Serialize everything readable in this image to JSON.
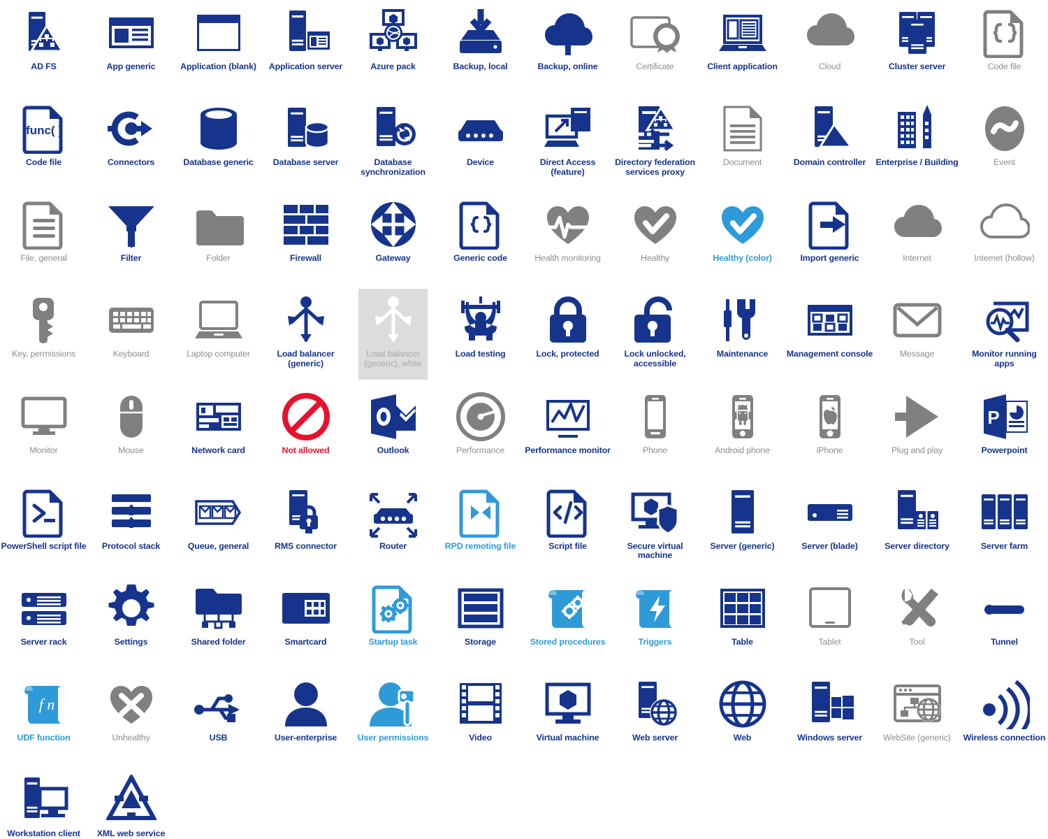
{
  "palette": {
    "dark_blue": "#16348c",
    "navy": "#13307f",
    "gray": "#808080",
    "label_gray": "#8d8d8d",
    "light_blue": "#2f9ad8",
    "red": "#e8112d",
    "white": "#ffffff",
    "shade_bg": "#dcdcdc",
    "background": "#ffffff"
  },
  "grid": {
    "columns": 12,
    "rows": 8,
    "total_icons": 96
  },
  "icons": [
    {
      "label": "AD FS",
      "color": "blue",
      "shape": "adfs"
    },
    {
      "label": "App generic",
      "color": "blue",
      "shape": "app-generic"
    },
    {
      "label": "Application (blank)",
      "color": "blue",
      "shape": "app-blank"
    },
    {
      "label": "Application server",
      "color": "blue",
      "shape": "app-server"
    },
    {
      "label": "Azure pack",
      "color": "blue",
      "shape": "azure-pack"
    },
    {
      "label": "Backup, local",
      "color": "blue",
      "shape": "backup-local"
    },
    {
      "label": "Backup, online",
      "color": "blue",
      "shape": "backup-online"
    },
    {
      "label": "Certificate",
      "color": "gray",
      "shape": "certificate"
    },
    {
      "label": "Client application",
      "color": "blue",
      "shape": "client-application"
    },
    {
      "label": "Cloud",
      "color": "gray",
      "shape": "cloud"
    },
    {
      "label": "Cluster server",
      "color": "blue",
      "shape": "cluster-server"
    },
    {
      "label": "Code file",
      "color": "gray",
      "shape": "code-file-braces"
    },
    {
      "label": "Code file",
      "color": "blue",
      "shape": "code-file-func"
    },
    {
      "label": "Connectors",
      "color": "blue",
      "shape": "connectors"
    },
    {
      "label": "Database generic",
      "color": "blue",
      "shape": "database-generic"
    },
    {
      "label": "Database server",
      "color": "blue",
      "shape": "database-server"
    },
    {
      "label": "Database synchronization",
      "color": "blue",
      "shape": "database-sync"
    },
    {
      "label": "Device",
      "color": "blue",
      "shape": "device"
    },
    {
      "label": "Direct Access (feature)",
      "color": "blue",
      "shape": "direct-access"
    },
    {
      "label": "Directory federation services proxy",
      "color": "blue",
      "shape": "dir-fed-proxy"
    },
    {
      "label": "Document",
      "color": "gray",
      "shape": "document"
    },
    {
      "label": "Domain controller",
      "color": "blue",
      "shape": "domain-controller"
    },
    {
      "label": "Enterprise / Building",
      "color": "blue",
      "shape": "enterprise-building"
    },
    {
      "label": "Event",
      "color": "gray",
      "shape": "event"
    },
    {
      "label": "File, general",
      "color": "gray",
      "shape": "file-general"
    },
    {
      "label": "Filter",
      "color": "blue",
      "shape": "filter"
    },
    {
      "label": "Folder",
      "color": "gray",
      "shape": "folder"
    },
    {
      "label": "Firewall",
      "color": "blue",
      "shape": "firewall"
    },
    {
      "label": "Gateway",
      "color": "blue",
      "shape": "gateway"
    },
    {
      "label": "Generic code",
      "color": "blue",
      "shape": "generic-code"
    },
    {
      "label": "Health monitoring",
      "color": "gray",
      "shape": "health-monitoring"
    },
    {
      "label": "Healthy",
      "color": "gray",
      "shape": "healthy"
    },
    {
      "label": "Healthy (color)",
      "color": "lblue",
      "shape": "healthy-color"
    },
    {
      "label": "Import generic",
      "color": "blue",
      "shape": "import-generic"
    },
    {
      "label": "Internet",
      "color": "gray",
      "shape": "internet"
    },
    {
      "label": "Internet (hollow)",
      "color": "gray",
      "shape": "internet-hollow"
    },
    {
      "label": "Key, permissions",
      "color": "gray",
      "shape": "key-permissions"
    },
    {
      "label": "Keyboard",
      "color": "gray",
      "shape": "keyboard"
    },
    {
      "label": "Laptop computer",
      "color": "gray",
      "shape": "laptop-computer"
    },
    {
      "label": "Load balancer (generic)",
      "color": "blue",
      "shape": "load-balancer"
    },
    {
      "label": "Load balancer (generic), white",
      "color": "white",
      "shape": "load-balancer-white",
      "shaded": true
    },
    {
      "label": "Load testing",
      "color": "blue",
      "shape": "load-testing"
    },
    {
      "label": "Lock, protected",
      "color": "blue",
      "shape": "lock-protected"
    },
    {
      "label": "Lock unlocked, accessible",
      "color": "blue",
      "shape": "lock-unlocked"
    },
    {
      "label": "Maintenance",
      "color": "blue",
      "shape": "maintenance"
    },
    {
      "label": "Management console",
      "color": "blue",
      "shape": "management-console"
    },
    {
      "label": "Message",
      "color": "gray",
      "shape": "message"
    },
    {
      "label": "Monitor running apps",
      "color": "blue",
      "shape": "monitor-running-apps"
    },
    {
      "label": "Monitor",
      "color": "gray",
      "shape": "monitor"
    },
    {
      "label": "Mouse",
      "color": "gray",
      "shape": "mouse"
    },
    {
      "label": "Network card",
      "color": "blue",
      "shape": "network-card"
    },
    {
      "label": "Not allowed",
      "color": "red",
      "shape": "not-allowed"
    },
    {
      "label": "Outlook",
      "color": "blue",
      "shape": "outlook"
    },
    {
      "label": "Performance",
      "color": "gray",
      "shape": "performance"
    },
    {
      "label": "Performance monitor",
      "color": "blue",
      "shape": "performance-monitor"
    },
    {
      "label": "Phone",
      "color": "gray",
      "shape": "phone"
    },
    {
      "label": "Android phone",
      "color": "gray",
      "shape": "android-phone"
    },
    {
      "label": "iPhone",
      "color": "gray",
      "shape": "iphone"
    },
    {
      "label": "Plug and play",
      "color": "gray",
      "shape": "plug-and-play"
    },
    {
      "label": "Powerpoint",
      "color": "blue",
      "shape": "powerpoint"
    },
    {
      "label": "PowerShell script file",
      "color": "blue",
      "shape": "powershell-script"
    },
    {
      "label": "Protocol stack",
      "color": "blue",
      "shape": "protocol-stack"
    },
    {
      "label": "Queue, general",
      "color": "blue",
      "shape": "queue-general"
    },
    {
      "label": "RMS connector",
      "color": "blue",
      "shape": "rms-connector"
    },
    {
      "label": "Router",
      "color": "blue",
      "shape": "router"
    },
    {
      "label": "RPD remoting file",
      "color": "lblue",
      "shape": "rpd-remoting-file"
    },
    {
      "label": "Script file",
      "color": "blue",
      "shape": "script-file"
    },
    {
      "label": "Secure virtual machine",
      "color": "blue",
      "shape": "secure-vm"
    },
    {
      "label": "Server (generic)",
      "color": "blue",
      "shape": "server-generic"
    },
    {
      "label": "Server (blade)",
      "color": "blue",
      "shape": "server-blade"
    },
    {
      "label": "Server directory",
      "color": "blue",
      "shape": "server-directory"
    },
    {
      "label": "Server farm",
      "color": "blue",
      "shape": "server-farm"
    },
    {
      "label": "Server rack",
      "color": "blue",
      "shape": "server-rack"
    },
    {
      "label": "Settings",
      "color": "blue",
      "shape": "settings"
    },
    {
      "label": "Shared folder",
      "color": "blue",
      "shape": "shared-folder"
    },
    {
      "label": "Smartcard",
      "color": "blue",
      "shape": "smartcard"
    },
    {
      "label": "Startup task",
      "color": "lblue",
      "shape": "startup-task"
    },
    {
      "label": "Storage",
      "color": "blue",
      "shape": "storage"
    },
    {
      "label": "Stored procedures",
      "color": "lblue",
      "shape": "stored-procedures"
    },
    {
      "label": "Triggers",
      "color": "lblue",
      "shape": "triggers"
    },
    {
      "label": "Table",
      "color": "blue",
      "shape": "table"
    },
    {
      "label": "Tablet",
      "color": "gray",
      "shape": "tablet"
    },
    {
      "label": "Tool",
      "color": "gray",
      "shape": "tool"
    },
    {
      "label": "Tunnel",
      "color": "blue",
      "shape": "tunnel"
    },
    {
      "label": "UDF function",
      "color": "lblue",
      "shape": "udf-function"
    },
    {
      "label": "Unhealthy",
      "color": "gray",
      "shape": "unhealthy"
    },
    {
      "label": "USB",
      "color": "blue",
      "shape": "usb"
    },
    {
      "label": "User-enterprise",
      "color": "blue",
      "shape": "user-enterprise"
    },
    {
      "label": "User permissions",
      "color": "lblue",
      "shape": "user-permissions"
    },
    {
      "label": "Video",
      "color": "blue",
      "shape": "video"
    },
    {
      "label": "Virtual machine",
      "color": "blue",
      "shape": "virtual-machine"
    },
    {
      "label": "Web server",
      "color": "blue",
      "shape": "web-server"
    },
    {
      "label": "Web",
      "color": "blue",
      "shape": "web"
    },
    {
      "label": "Windows server",
      "color": "blue",
      "shape": "windows-server"
    },
    {
      "label": "WebSite (generic)",
      "color": "gray",
      "shape": "website-generic"
    },
    {
      "label": "Wireless connection",
      "color": "blue",
      "shape": "wireless-connection"
    },
    {
      "label": "Workstation client",
      "color": "blue",
      "shape": "workstation-client"
    },
    {
      "label": "XML web service",
      "color": "blue",
      "shape": "xml-web-service"
    }
  ]
}
